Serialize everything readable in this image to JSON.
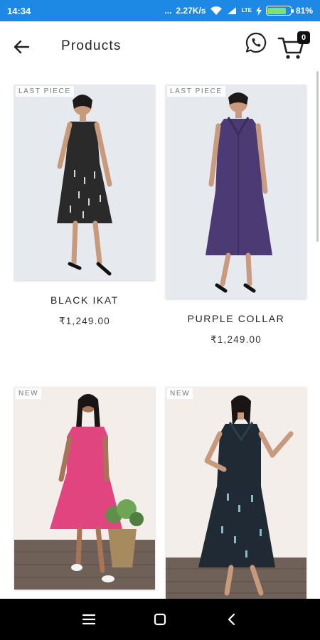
{
  "status_bar": {
    "time": "14:34",
    "dots": "...",
    "speed": "2.27K/s",
    "lte": "LTE",
    "battery_percent": "81%",
    "battery_level": 0.81
  },
  "app_bar": {
    "title": "Products",
    "cart_count": "0"
  },
  "products": [
    {
      "tag": "LAST PIECE",
      "name": "BLACK IKAT",
      "price": "₹1,249.00",
      "color": "#2a2a2a"
    },
    {
      "tag": "LAST PIECE",
      "name": "PURPLE COLLAR",
      "price": "₹1,249.00",
      "color": "#4b3a73"
    },
    {
      "tag": "NEW",
      "name": "",
      "price": "",
      "color": "#e0457f"
    },
    {
      "tag": "NEW",
      "name": "",
      "price": "",
      "color": "#1f2a35"
    }
  ],
  "colors": {
    "status_bar": "#1e88e5",
    "nav_bar": "#000000"
  }
}
